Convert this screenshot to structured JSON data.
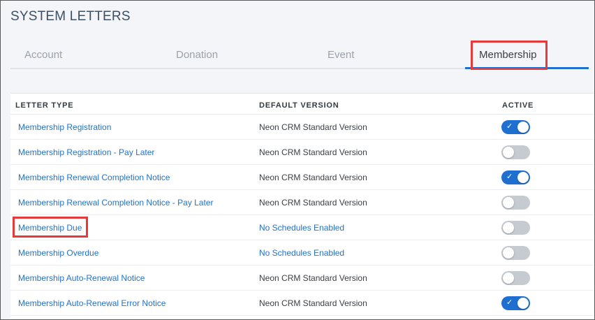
{
  "page": {
    "title": "SYSTEM LETTERS"
  },
  "tabs": [
    {
      "label": "Account",
      "active": false
    },
    {
      "label": "Donation",
      "active": false
    },
    {
      "label": "Event",
      "active": false
    },
    {
      "label": "Membership",
      "active": true
    }
  ],
  "table": {
    "headers": {
      "letter_type": "LETTER TYPE",
      "default_version": "DEFAULT VERSION",
      "active": "ACTIVE"
    },
    "rows": [
      {
        "letter_type": "Membership Registration",
        "default_version": "Neon CRM Standard Version",
        "version_is_link": false,
        "active": true
      },
      {
        "letter_type": "Membership Registration - Pay Later",
        "default_version": "Neon CRM Standard Version",
        "version_is_link": false,
        "active": false
      },
      {
        "letter_type": "Membership Renewal Completion Notice",
        "default_version": "Neon CRM Standard Version",
        "version_is_link": false,
        "active": true
      },
      {
        "letter_type": "Membership Renewal Completion Notice - Pay Later",
        "default_version": "Neon CRM Standard Version",
        "version_is_link": false,
        "active": false
      },
      {
        "letter_type": "Membership Due",
        "default_version": "No Schedules Enabled",
        "version_is_link": true,
        "active": false
      },
      {
        "letter_type": "Membership Overdue",
        "default_version": "No Schedules Enabled",
        "version_is_link": true,
        "active": false
      },
      {
        "letter_type": "Membership Auto-Renewal Notice",
        "default_version": "Neon CRM Standard Version",
        "version_is_link": false,
        "active": false
      },
      {
        "letter_type": "Membership Auto-Renewal Error Notice",
        "default_version": "Neon CRM Standard Version",
        "version_is_link": false,
        "active": true
      }
    ]
  },
  "colors": {
    "accent": "#1f6fd1",
    "link": "#2472c8",
    "highlight": "#e5393a",
    "toggle_off": "#c6cbd2"
  },
  "icons": {
    "toggle_check": "check-icon"
  }
}
